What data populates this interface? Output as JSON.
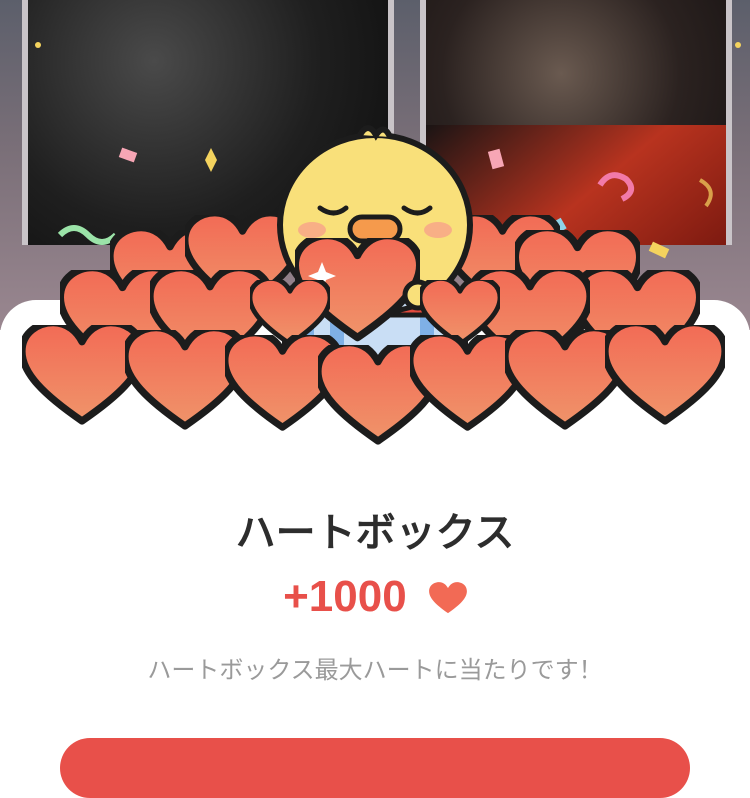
{
  "result": {
    "title": "ハートボックス",
    "amount": "+1000",
    "message": "ハートボックス最大ハートに当たりです！"
  },
  "icons": {
    "reward_icon": "heart-icon",
    "mascot": "yellow-chick-mascot",
    "decoration": "hearts-pile"
  },
  "colors": {
    "accent": "#e8504a",
    "heart": "#f26a55",
    "title_text": "#2d2d2d",
    "message_text": "#9a9a9a"
  }
}
